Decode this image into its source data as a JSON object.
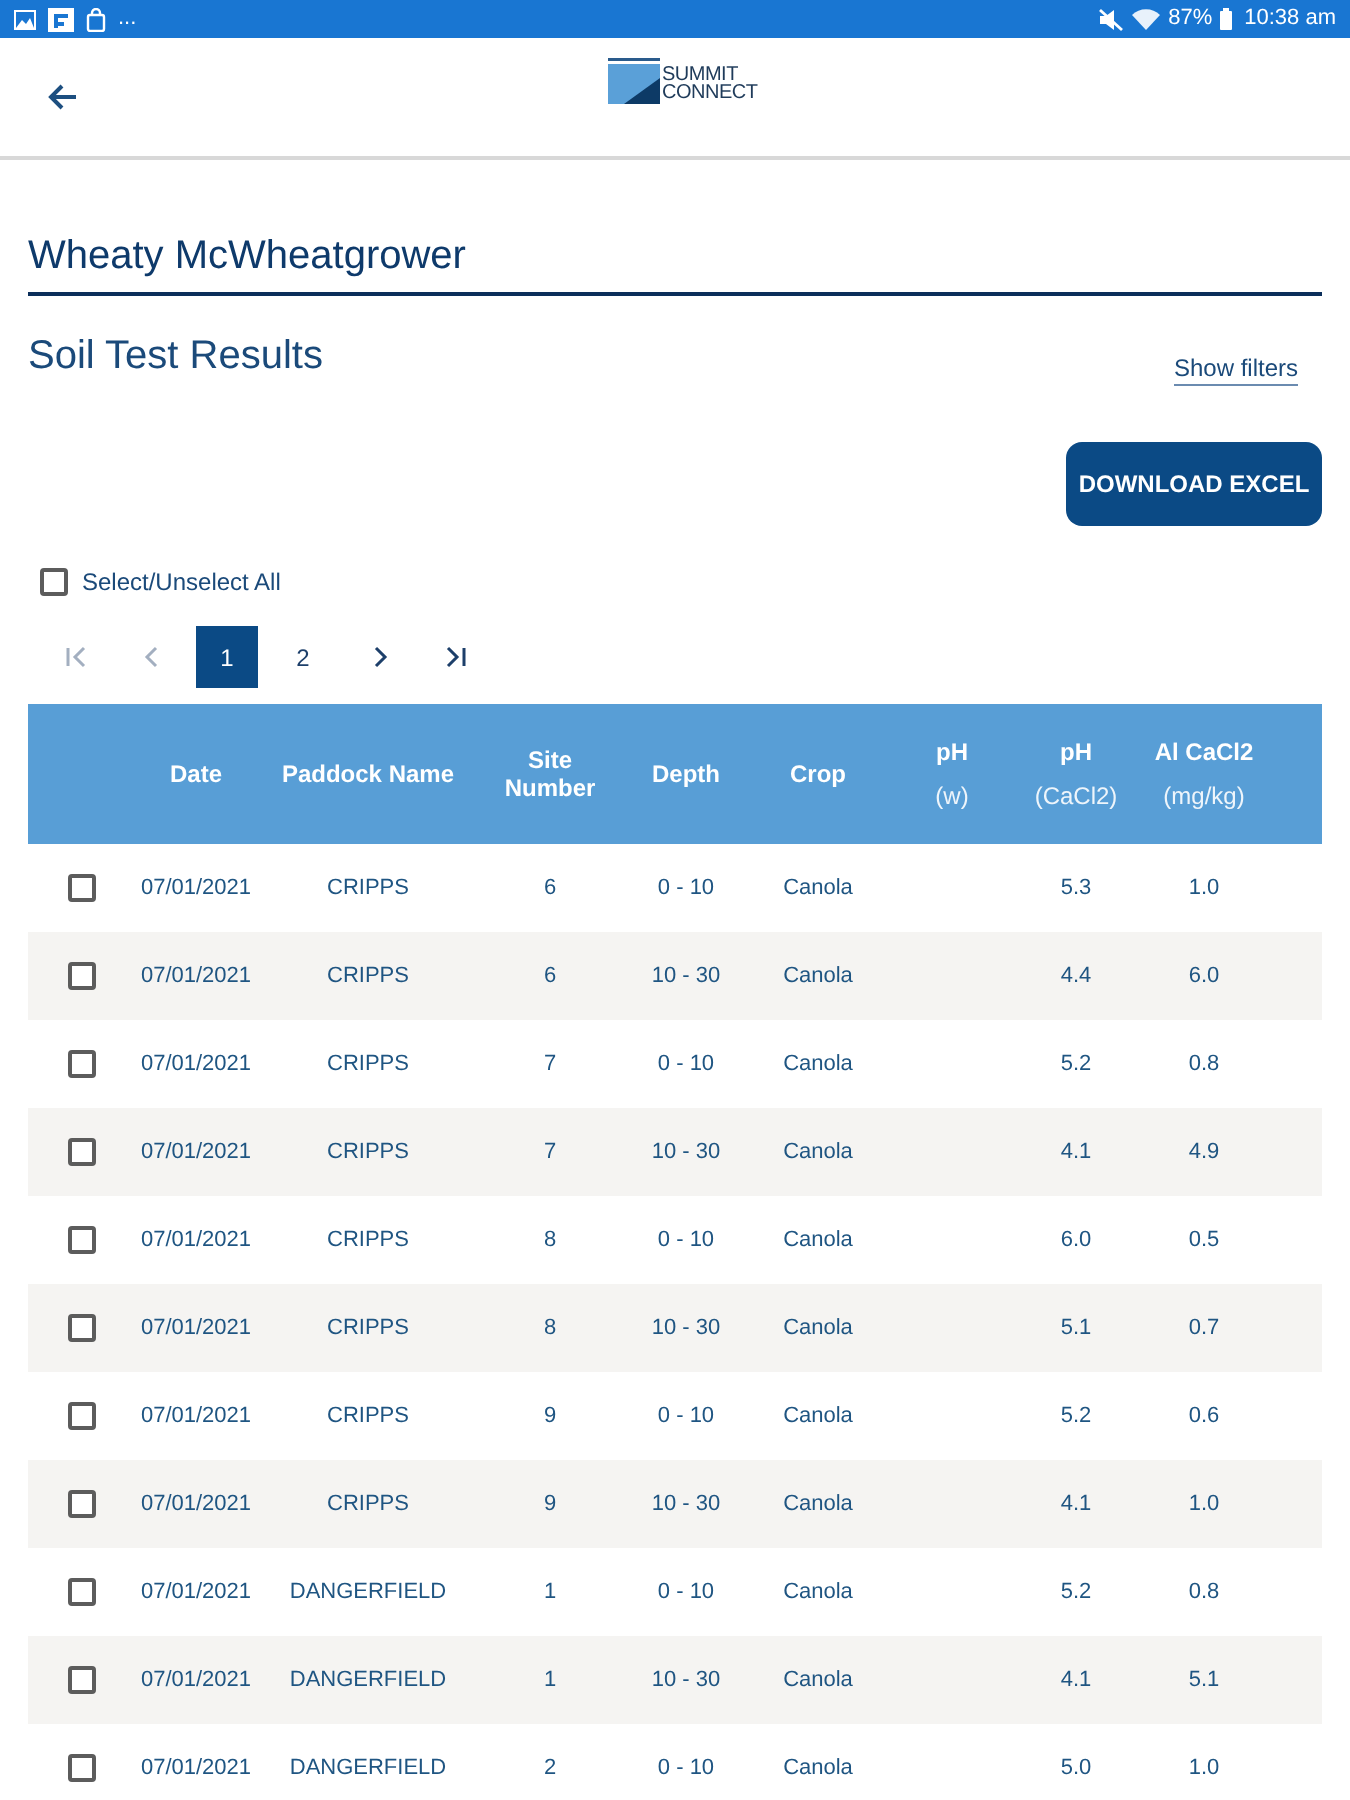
{
  "status_bar": {
    "more": "...",
    "battery": "87%",
    "time": "10:38 am"
  },
  "app_bar": {
    "logo": {
      "line_1": "SUMMIT",
      "line_2": "CONNECT"
    }
  },
  "grower_name": "Wheaty McWheatgrower",
  "section": {
    "title": "Soil Test Results",
    "filters_link": "Show filters",
    "download_button": "DOWNLOAD EXCEL"
  },
  "select_all": {
    "label": "Select/Unselect All",
    "checked": false
  },
  "pagination": [
    {
      "kind": "first",
      "disabled": true
    },
    {
      "kind": "previous",
      "disabled": true
    },
    {
      "kind": "page",
      "label": "1",
      "selected": true
    },
    {
      "kind": "page",
      "label": "2",
      "selected": false
    },
    {
      "kind": "next",
      "disabled": false
    },
    {
      "kind": "last",
      "disabled": false
    }
  ],
  "table": {
    "columns": [
      {
        "label": "Date"
      },
      {
        "label": "Paddock Name"
      },
      {
        "label": "Site Number"
      },
      {
        "label": "Depth"
      },
      {
        "label": "Crop"
      },
      {
        "label": "pH",
        "unit": "(w)"
      },
      {
        "label": "pH",
        "unit": "(CaCl2)"
      },
      {
        "label": "Al CaCl2",
        "unit": "(mg/kg)"
      }
    ],
    "rows": [
      {
        "checked": false,
        "date": "07/01/2021",
        "paddock_name": "CRIPPS",
        "site_number": "6",
        "depth": "0 - 10",
        "crop": "Canola",
        "ph_cacl2": "5.3",
        "al_cacl2": "1.0"
      },
      {
        "checked": false,
        "date": "07/01/2021",
        "paddock_name": "CRIPPS",
        "site_number": "6",
        "depth": "10 - 30",
        "crop": "Canola",
        "ph_cacl2": "4.4",
        "al_cacl2": "6.0"
      },
      {
        "checked": false,
        "date": "07/01/2021",
        "paddock_name": "CRIPPS",
        "site_number": "7",
        "depth": "0 - 10",
        "crop": "Canola",
        "ph_cacl2": "5.2",
        "al_cacl2": "0.8"
      },
      {
        "checked": false,
        "date": "07/01/2021",
        "paddock_name": "CRIPPS",
        "site_number": "7",
        "depth": "10 - 30",
        "crop": "Canola",
        "ph_cacl2": "4.1",
        "al_cacl2": "4.9"
      },
      {
        "checked": false,
        "date": "07/01/2021",
        "paddock_name": "CRIPPS",
        "site_number": "8",
        "depth": "0 - 10",
        "crop": "Canola",
        "ph_cacl2": "6.0",
        "al_cacl2": "0.5"
      },
      {
        "checked": false,
        "date": "07/01/2021",
        "paddock_name": "CRIPPS",
        "site_number": "8",
        "depth": "10 - 30",
        "crop": "Canola",
        "ph_cacl2": "5.1",
        "al_cacl2": "0.7"
      },
      {
        "checked": false,
        "date": "07/01/2021",
        "paddock_name": "CRIPPS",
        "site_number": "9",
        "depth": "0 - 10",
        "crop": "Canola",
        "ph_cacl2": "5.2",
        "al_cacl2": "0.6"
      },
      {
        "checked": false,
        "date": "07/01/2021",
        "paddock_name": "CRIPPS",
        "site_number": "9",
        "depth": "10 - 30",
        "crop": "Canola",
        "ph_cacl2": "4.1",
        "al_cacl2": "1.0"
      },
      {
        "checked": false,
        "date": "07/01/2021",
        "paddock_name": "DANGERFIELD",
        "site_number": "1",
        "depth": "0 - 10",
        "crop": "Canola",
        "ph_cacl2": "5.2",
        "al_cacl2": "0.8"
      },
      {
        "checked": false,
        "date": "07/01/2021",
        "paddock_name": "DANGERFIELD",
        "site_number": "1",
        "depth": "10 - 30",
        "crop": "Canola",
        "ph_cacl2": "4.1",
        "al_cacl2": "5.1"
      },
      {
        "checked": false,
        "date": "07/01/2021",
        "paddock_name": "DANGERFIELD",
        "site_number": "2",
        "depth": "0 - 10",
        "crop": "Canola",
        "ph_cacl2": "5.0",
        "al_cacl2": "1.0"
      }
    ]
  }
}
